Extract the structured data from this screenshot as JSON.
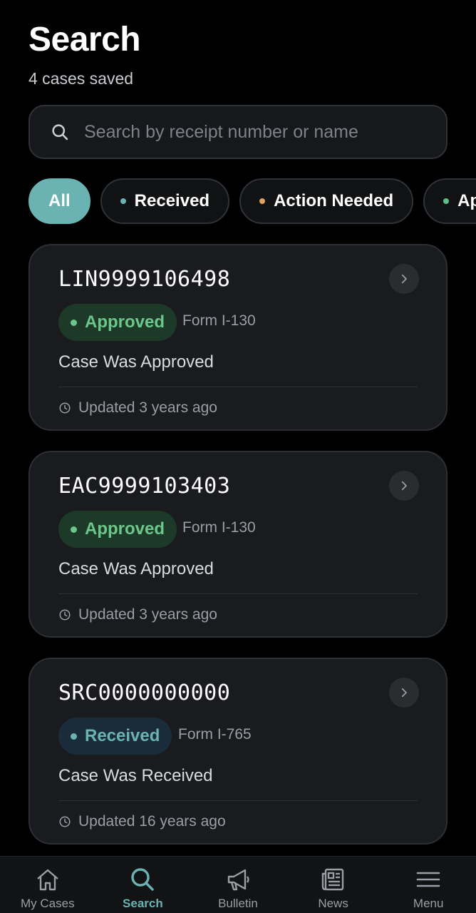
{
  "header": {
    "title": "Search",
    "subtitle": "4 cases saved"
  },
  "search": {
    "placeholder": "Search by receipt number or name",
    "value": ""
  },
  "filters": [
    {
      "label": "All",
      "active": true
    },
    {
      "label": "Received",
      "dot_color": "#6bb3b3"
    },
    {
      "label": "Action Needed",
      "dot_color": "#e0a060"
    },
    {
      "label": "App",
      "dot_color": "#5bc08a"
    }
  ],
  "cases": [
    {
      "number": "LIN9999106498",
      "status": "Approved",
      "form": "Form I-130",
      "description": "Case Was Approved",
      "updated": "Updated 3 years ago"
    },
    {
      "number": "EAC9999103403",
      "status": "Approved",
      "form": "Form I-130",
      "description": "Case Was Approved",
      "updated": "Updated 3 years ago"
    },
    {
      "number": "SRC0000000000",
      "status": "Received",
      "form": "Form I-765",
      "description": "Case Was Received",
      "updated": "Updated 16 years ago"
    }
  ],
  "tabs": [
    {
      "label": "My Cases",
      "icon": "home-icon"
    },
    {
      "label": "Search",
      "icon": "search-icon",
      "active": true
    },
    {
      "label": "Bulletin",
      "icon": "megaphone-icon"
    },
    {
      "label": "News",
      "icon": "newspaper-icon"
    },
    {
      "label": "Menu",
      "icon": "menu-icon"
    }
  ],
  "colors": {
    "accent": "#6bb3b3",
    "approved_bg": "#1d3a29",
    "approved_fg": "#6cc78b",
    "received_bg": "#1a2c3a",
    "received_fg": "#6bb3b3"
  }
}
